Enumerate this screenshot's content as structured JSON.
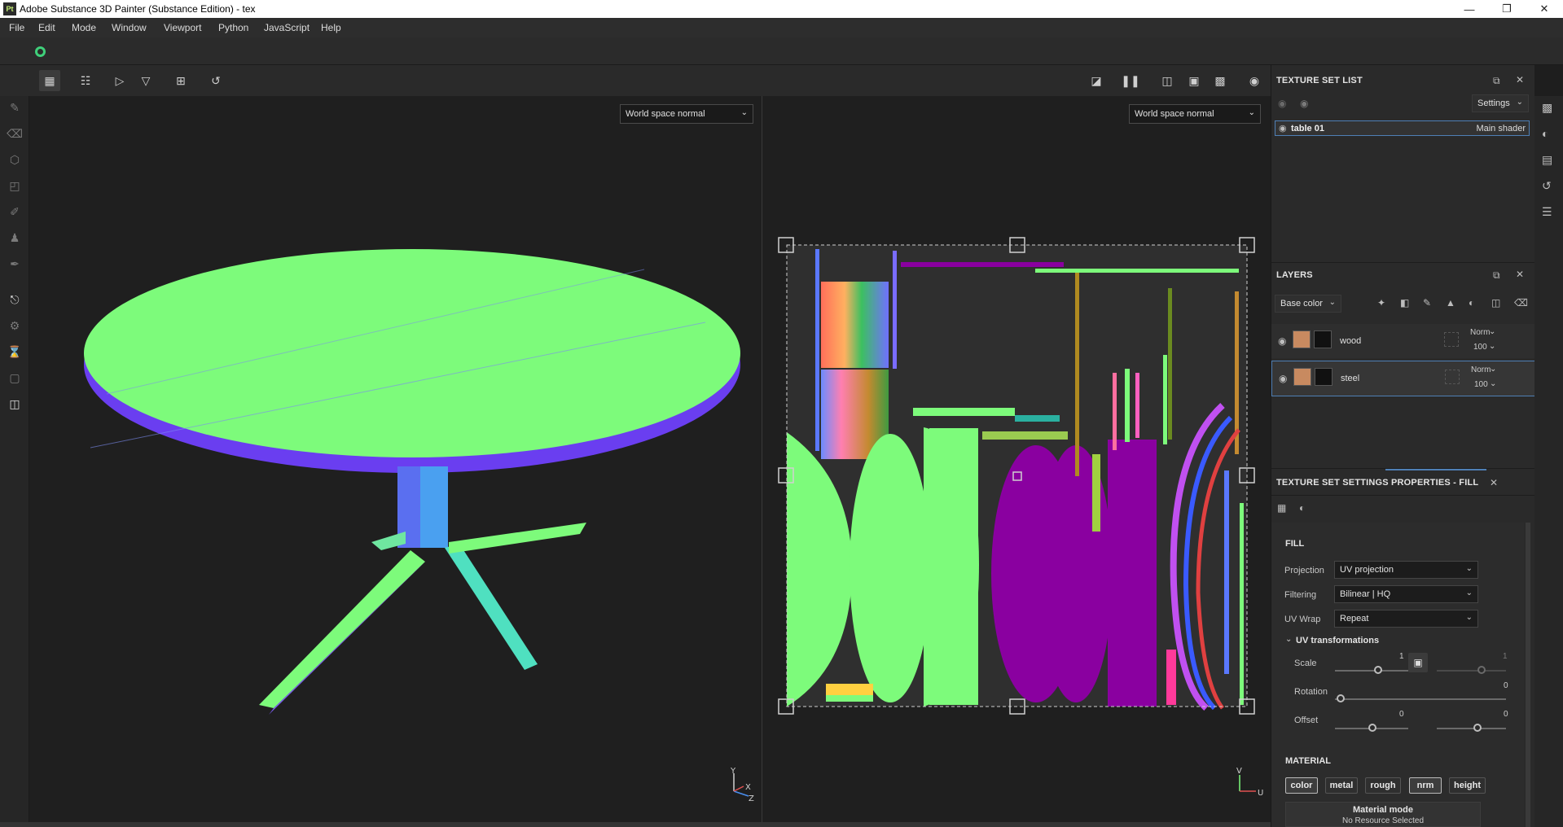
{
  "window": {
    "title": "Adobe Substance 3D Painter (Substance Edition) - tex",
    "app_icon": "Pt"
  },
  "menu": [
    "File",
    "Edit",
    "Mode",
    "Window",
    "Viewport",
    "Python",
    "JavaScript",
    "Help"
  ],
  "viewport3d": {
    "channel_select": "World space normal",
    "axis": {
      "y": "Y",
      "x": "X",
      "z": "Z"
    }
  },
  "viewport2d": {
    "channel_select": "World space normal",
    "axis": {
      "v": "V",
      "u": "U"
    }
  },
  "texture_set_list": {
    "title": "TEXTURE SET LIST",
    "settings_label": "Settings",
    "items": [
      {
        "name": "table 01",
        "shader": "Main shader"
      }
    ]
  },
  "layers": {
    "title": "LAYERS",
    "channel": "Base color",
    "items": [
      {
        "name": "wood",
        "blend": "Norm",
        "opacity": "100"
      },
      {
        "name": "steel",
        "blend": "Norm",
        "opacity": "100"
      }
    ]
  },
  "properties": {
    "tab_settings": "TEXTURE SET SETTINGS",
    "tab_fill": "PROPERTIES - FILL",
    "fill_header": "FILL",
    "projection_label": "Projection",
    "projection_value": "UV projection",
    "filtering_label": "Filtering",
    "filtering_value": "Bilinear | HQ",
    "uvwrap_label": "UV Wrap",
    "uvwrap_value": "Repeat",
    "uv_transform_label": "UV transformations",
    "scale_label": "Scale",
    "scale_value": "1",
    "scale_value2": "1",
    "rotation_label": "Rotation",
    "rotation_value": "0",
    "offset_label": "Offset",
    "offset_x": "0",
    "offset_y": "0",
    "material_header": "MATERIAL",
    "material_chips": [
      "color",
      "metal",
      "rough",
      "nrm",
      "height"
    ],
    "material_mode_label": "Material mode",
    "material_mode_value": "No Resource Selected"
  },
  "colors": {
    "accent": "#4f7fb5",
    "normal_green": "#7dfb7b",
    "normal_purple": "#8a00a0"
  }
}
